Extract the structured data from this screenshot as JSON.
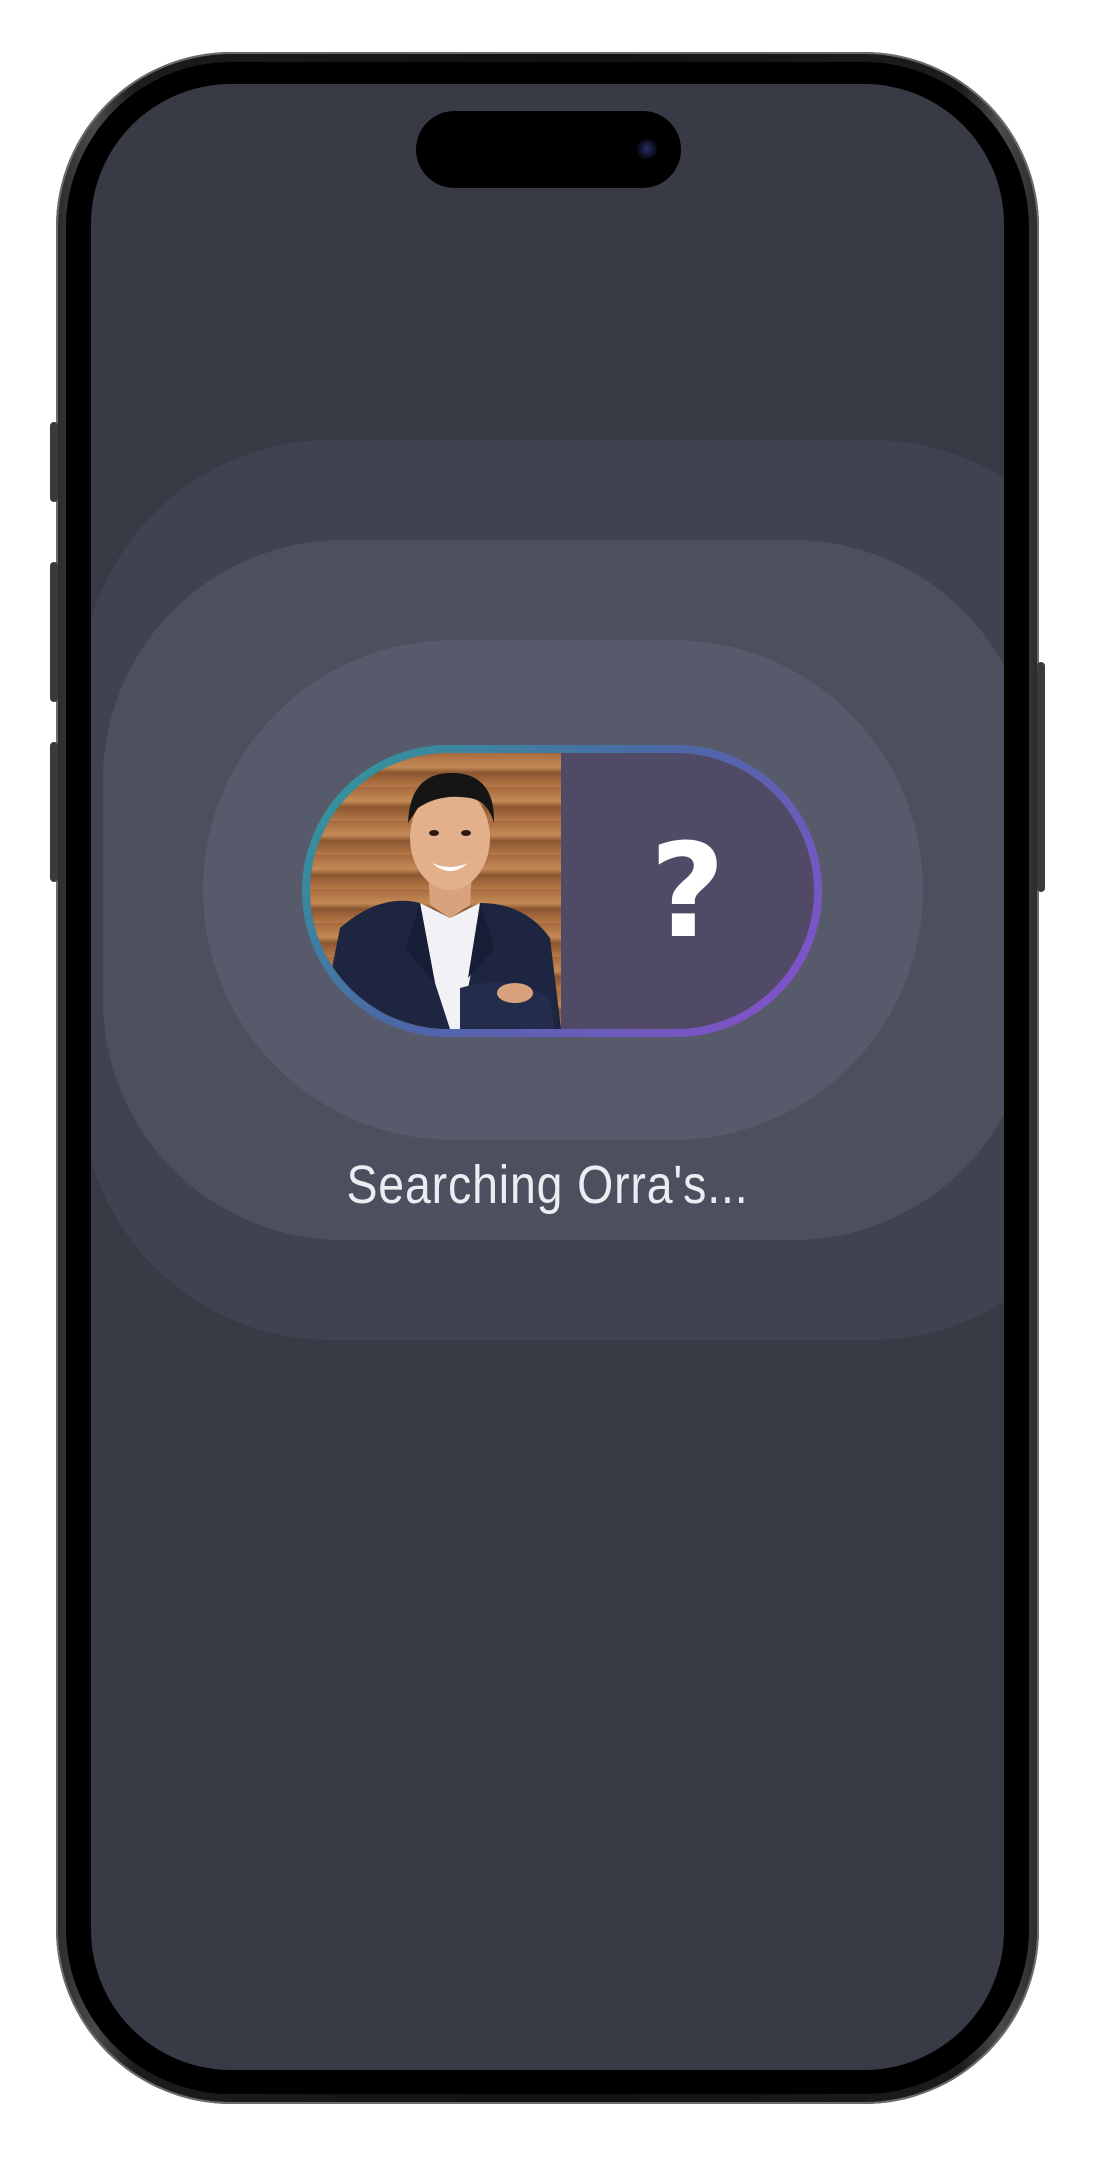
{
  "device": {
    "frame_color": "#1c1c1e",
    "screen_color": "#383a46"
  },
  "search": {
    "status_text": "Searching Orra's...",
    "unknown_glyph": "?",
    "avatar_icon": "user-photo",
    "unknown_icon": "question-mark-icon",
    "accent_gradient": [
      "#2f9d9a",
      "#4b68a6",
      "#8a4fd0"
    ]
  }
}
